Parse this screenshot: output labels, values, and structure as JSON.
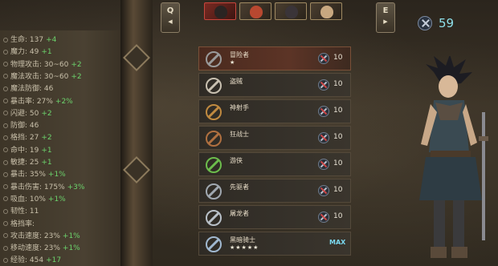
{
  "stats": [
    {
      "label": "生命: 137",
      "bonus": "+4"
    },
    {
      "label": "魔力: 49",
      "bonus": "+1"
    },
    {
      "label": "物理攻击: 30~60",
      "bonus": "+2"
    },
    {
      "label": "魔法攻击: 30~60",
      "bonus": "+2"
    },
    {
      "label": "魔法防御: 46",
      "bonus": ""
    },
    {
      "label": "暴击率: 27%",
      "bonus": "+2%"
    },
    {
      "label": "闪避: 50",
      "bonus": "+2"
    },
    {
      "label": "防御: 46",
      "bonus": ""
    },
    {
      "label": "格挡: 27",
      "bonus": "+2"
    },
    {
      "label": "命中: 19",
      "bonus": "+1"
    },
    {
      "label": "敏捷: 25",
      "bonus": "+1"
    },
    {
      "label": "暴击: 35%",
      "bonus": "+1%"
    },
    {
      "label": "暴击伤害: 175%",
      "bonus": "+3%"
    },
    {
      "label": "吸血: 10%",
      "bonus": "+1%"
    },
    {
      "label": "韧性: 11",
      "bonus": ""
    },
    {
      "label": "格挡率: ",
      "bonus": ""
    },
    {
      "label": "攻击速度: 23%",
      "bonus": "+1%"
    },
    {
      "label": "移动速度: 23%",
      "bonus": "+1%"
    },
    {
      "label": "经验: 454",
      "bonus": "+17"
    }
  ],
  "nav": {
    "prev_key": "Q",
    "next_key": "E",
    "prev_arrow": "◀",
    "next_arrow": "▶"
  },
  "currency": {
    "value": "59"
  },
  "classes": [
    {
      "name": "冒险者",
      "stars": "★",
      "req": "10",
      "icon": "axe-icon",
      "color": "#9a9a9a"
    },
    {
      "name": "盗贼",
      "stars": "",
      "req": "10",
      "icon": "dagger-icon",
      "color": "#c8c0b0"
    },
    {
      "name": "神射手",
      "stars": "",
      "req": "10",
      "icon": "bow-icon",
      "color": "#c08a40"
    },
    {
      "name": "狂战士",
      "stars": "",
      "req": "10",
      "icon": "chain-icon",
      "color": "#b07040"
    },
    {
      "name": "游侠",
      "stars": "",
      "req": "10",
      "icon": "herb-icon",
      "color": "#6cbc4c"
    },
    {
      "name": "先驱者",
      "stars": "",
      "req": "10",
      "icon": "spear-icon",
      "color": "#a0a8b0"
    },
    {
      "name": "屠龙者",
      "stars": "",
      "req": "10",
      "icon": "sword-icon",
      "color": "#b8c0c8"
    },
    {
      "name": "黑暗骑士",
      "stars": "★★★★★",
      "req": "MAX",
      "icon": "crystal-icon",
      "color": "#a0b8d0"
    }
  ]
}
